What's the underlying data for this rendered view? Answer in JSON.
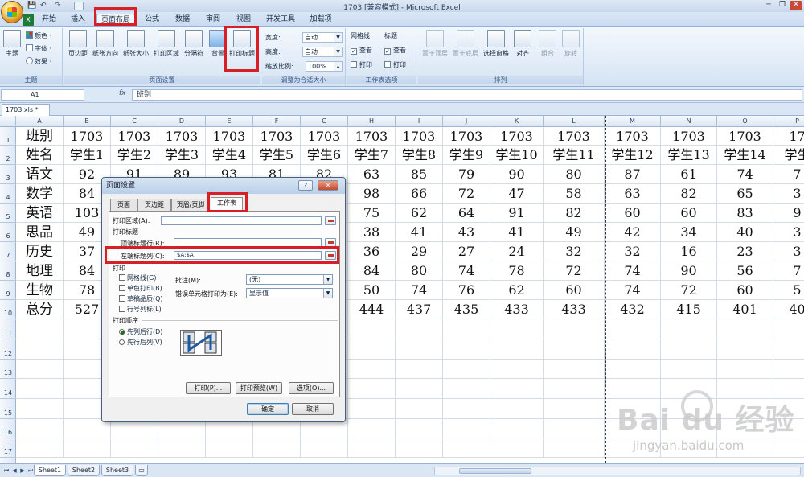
{
  "window": {
    "title": "1703  [兼容模式] - Microsoft Excel",
    "qat_save": "💾",
    "qat_undo": "↶",
    "qat_redo": "↷",
    "minimize": "─",
    "restore": "❐",
    "close": "✕"
  },
  "ribbon_tabs": [
    {
      "label": "开始",
      "active": false
    },
    {
      "label": "插入",
      "active": false
    },
    {
      "label": "页面布局",
      "active": true
    },
    {
      "label": "公式",
      "active": false
    },
    {
      "label": "数据",
      "active": false
    },
    {
      "label": "审阅",
      "active": false
    },
    {
      "label": "视图",
      "active": false
    },
    {
      "label": "开发工具",
      "active": false
    },
    {
      "label": "加载项",
      "active": false
    }
  ],
  "ribbon": {
    "theme": {
      "label": "主题",
      "btn": "主题",
      "colors": "颜色 ·",
      "fonts": "字体 ·",
      "effects": "效果 ·"
    },
    "page_setup": {
      "label": "页面设置",
      "margins": "页边距",
      "orientation": "纸张方向",
      "size": "纸张大小",
      "print_area": "打印区域",
      "breaks": "分隔符",
      "background": "背景",
      "print_titles": "打印标题"
    },
    "scale": {
      "label": "调整为合适大小",
      "width_label": "宽度:",
      "width_value": "自动",
      "height_label": "高度:",
      "height_value": "自动",
      "scale_label": "缩放比例:",
      "scale_value": "100%"
    },
    "sheet_options": {
      "label": "工作表选项",
      "gridlines": "网格线",
      "headings": "标题",
      "view": "查看",
      "print": "打印"
    },
    "arrange": {
      "label": "排列",
      "bring_front": "置于顶层",
      "send_back": "置于底层",
      "selection_pane": "选择窗格",
      "align": "对齐",
      "group": "组合",
      "rotate": "旋转"
    }
  },
  "formula": {
    "name_box": "A1",
    "fx": "fx",
    "value": "班别"
  },
  "doc_tab": "1703.xls *",
  "columns": [
    "A",
    "B",
    "C",
    "D",
    "E",
    "F",
    "C",
    "H",
    "I",
    "J",
    "K",
    "L",
    "M",
    "N",
    "O",
    "P"
  ],
  "rows": [
    "1",
    "2",
    "3",
    "4",
    "5",
    "6",
    "7",
    "8",
    "9",
    "10",
    "11",
    "12",
    "13",
    "14",
    "15",
    "16",
    "17"
  ],
  "table": {
    "r1": [
      "班别",
      "1703",
      "1703",
      "1703",
      "1703",
      "1703",
      "1703",
      "1703",
      "1703",
      "1703",
      "1703",
      "1703",
      "1703",
      "1703",
      "1703",
      "17"
    ],
    "r2": [
      "姓名",
      "学生1",
      "学生2",
      "学生3",
      "学生4",
      "学生5",
      "学生6",
      "学生7",
      "学生8",
      "学生9",
      "学生10",
      "学生11",
      "学生12",
      "学生13",
      "学生14",
      "学生"
    ],
    "r3": [
      "语文",
      "92",
      "91",
      "89",
      "93",
      "81",
      "82",
      "63",
      "85",
      "79",
      "90",
      "80",
      "87",
      "61",
      "74",
      "7"
    ],
    "r4": [
      "数学",
      "84",
      "",
      "",
      "",
      "",
      "",
      "98",
      "66",
      "72",
      "47",
      "58",
      "63",
      "82",
      "65",
      "3"
    ],
    "r5": [
      "英语",
      "103",
      "",
      "",
      "",
      "",
      "",
      "75",
      "62",
      "64",
      "91",
      "82",
      "60",
      "60",
      "83",
      "9"
    ],
    "r6": [
      "思品",
      "49",
      "",
      "",
      "",
      "",
      "",
      "38",
      "41",
      "43",
      "41",
      "49",
      "42",
      "34",
      "40",
      "3"
    ],
    "r7": [
      "历史",
      "37",
      "",
      "",
      "",
      "",
      "",
      "36",
      "29",
      "27",
      "24",
      "32",
      "32",
      "16",
      "23",
      "3"
    ],
    "r8": [
      "地理",
      "84",
      "",
      "",
      "",
      "",
      "",
      "84",
      "80",
      "74",
      "78",
      "72",
      "74",
      "90",
      "56",
      "7"
    ],
    "r9": [
      "生物",
      "78",
      "",
      "",
      "",
      "",
      "",
      "50",
      "74",
      "76",
      "62",
      "60",
      "74",
      "72",
      "60",
      "5"
    ],
    "r10": [
      "总分",
      "527",
      "",
      "",
      "",
      "",
      "",
      "444",
      "437",
      "435",
      "433",
      "433",
      "432",
      "415",
      "401",
      "40"
    ]
  },
  "sheets": [
    {
      "label": "Sheet1",
      "active": true
    },
    {
      "label": "Sheet2",
      "active": false
    },
    {
      "label": "Sheet3",
      "active": false
    }
  ],
  "dialog": {
    "title": "页面设置",
    "help": "?",
    "close": "✕",
    "tabs": [
      {
        "label": "页面",
        "active": false
      },
      {
        "label": "页边距",
        "active": false
      },
      {
        "label": "页眉/页脚",
        "active": false
      },
      {
        "label": "工作表",
        "active": true
      }
    ],
    "print_area_label": "打印区域(A):",
    "print_titles_label": "打印标题",
    "rows_repeat_label": "顶端标题行(R):",
    "cols_repeat_label": "左端标题列(C):",
    "cols_repeat_value": "$A:$A",
    "print_label": "打印",
    "gridlines": "网格线(G)",
    "black_white": "单色打印(B)",
    "draft": "草稿品质(Q)",
    "row_col_headings": "行号列标(L)",
    "comments_label": "批注(M):",
    "comments_value": "(无)",
    "errors_label": "错误单元格打印为(E):",
    "errors_value": "显示值",
    "order_label": "打印顺序",
    "down_then_over": "先列后行(D)",
    "over_then_down": "先行后列(V)",
    "print_btn": "打印(P)...",
    "preview_btn": "打印预览(W)",
    "options_btn": "选项(O)...",
    "ok_btn": "确定",
    "cancel_btn": "取消"
  },
  "watermark": {
    "brand": "Bai du 经验",
    "url": "jingyan.baidu.com"
  }
}
